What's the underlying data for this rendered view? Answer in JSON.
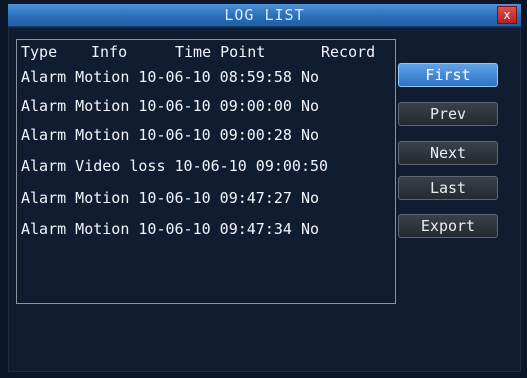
{
  "window": {
    "title": "LOG LIST",
    "close_label": "x"
  },
  "log_table": {
    "columns": [
      "Type",
      "Info",
      "Time Point",
      "Record"
    ],
    "rows": [
      "Alarm Motion 10-06-10 08:59:58 No",
      "Alarm Motion 10-06-10 09:00:00 No",
      "Alarm Motion 10-06-10 09:00:28 No",
      "Alarm Video loss 10-06-10 09:00:50",
      "Alarm Motion 10-06-10 09:47:27 No",
      "Alarm Motion 10-06-10 09:47:34 No"
    ]
  },
  "buttons": {
    "first": "First",
    "prev": "Prev",
    "next": "Next",
    "last": "Last",
    "export": "Export"
  },
  "colors": {
    "active_button": "#3d86d6",
    "title_bar": "#2a6fb8",
    "close_button": "#c82a2a"
  }
}
